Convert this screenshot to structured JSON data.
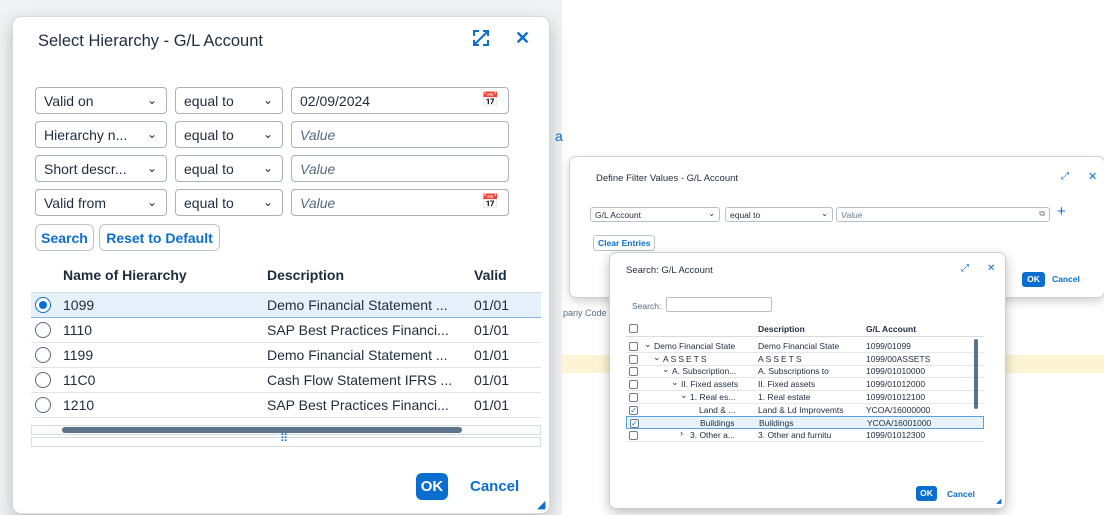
{
  "left_dialog": {
    "title": "Select Hierarchy - G/L Account",
    "filters": [
      {
        "field": "Valid on",
        "operator": "equal to",
        "value": "02/09/2024",
        "placeholder": "",
        "has_calendar": true
      },
      {
        "field": "Hierarchy n...",
        "operator": "equal to",
        "value": "",
        "placeholder": "Value",
        "has_calendar": false
      },
      {
        "field": "Short descr...",
        "operator": "equal to",
        "value": "",
        "placeholder": "Value",
        "has_calendar": false
      },
      {
        "field": "Valid from",
        "operator": "equal to",
        "value": "",
        "placeholder": "Value",
        "has_calendar": true
      }
    ],
    "search_button": "Search",
    "reset_button": "Reset to Default",
    "columns": [
      "Name of Hierarchy",
      "Description",
      "Valid"
    ],
    "rows": [
      {
        "name": "1099",
        "description": "Demo Financial Statement ...",
        "valid": "01/01",
        "selected": true
      },
      {
        "name": "1110",
        "description": "SAP Best Practices Financi...",
        "valid": "01/01",
        "selected": false
      },
      {
        "name": "1199",
        "description": "Demo Financial Statement ...",
        "valid": "01/01",
        "selected": false
      },
      {
        "name": "11C0",
        "description": "Cash Flow Statement IFRS ...",
        "valid": "01/01",
        "selected": false
      },
      {
        "name": "1210",
        "description": "SAP Best Practices Financi...",
        "valid": "01/01",
        "selected": false
      }
    ],
    "ok_label": "OK",
    "cancel_label": "Cancel"
  },
  "background_fragments": {
    "company_code_label": "pany Code"
  },
  "filter_dialog": {
    "title": "Define Filter Values - G/L Account",
    "field": "G/L Account",
    "operator": "equal to",
    "placeholder": "Value",
    "clear_button": "Clear Entries",
    "ok_label": "OK",
    "cancel_label": "Cancel"
  },
  "search_dialog": {
    "title": "Search: G/L Account",
    "search_label": "Search:",
    "search_value": "",
    "columns": [
      "",
      "Description",
      "G/L Account"
    ],
    "rows": [
      {
        "node": "Demo Financial State",
        "expander": "v",
        "indent": 0,
        "description": "Demo Financial State",
        "account": "1099/01099",
        "checked": false
      },
      {
        "node": "ASSETS",
        "expander": "v",
        "indent": 1,
        "description": "ASSETS",
        "account": "1099/00ASSETS",
        "checked": false
      },
      {
        "node": "A. Subscription...",
        "expander": "v",
        "indent": 2,
        "description": "A. Subscriptions to",
        "account": "1099/01010000",
        "checked": false
      },
      {
        "node": "II. Fixed assets",
        "expander": "v",
        "indent": 3,
        "description": "II. Fixed assets",
        "account": "1099/01012000",
        "checked": false
      },
      {
        "node": "1. Real es...",
        "expander": "v",
        "indent": 4,
        "description": "1. Real estate",
        "account": "1099/01012100",
        "checked": false
      },
      {
        "node": "Land & ...",
        "expander": "",
        "indent": 5,
        "description": "Land & Ld Improvemts",
        "account": "YCOA/16000000",
        "checked": true
      },
      {
        "node": "Buildings",
        "expander": "",
        "indent": 5,
        "description": "Buildings",
        "account": "YCOA/16001000",
        "checked": true
      },
      {
        "node": "3. Other a...",
        "expander": ">",
        "indent": 4,
        "description": "3. Other and furnitu",
        "account": "1099/01012300",
        "checked": false
      }
    ],
    "ok_label": "OK",
    "cancel_label": "Cancel"
  }
}
